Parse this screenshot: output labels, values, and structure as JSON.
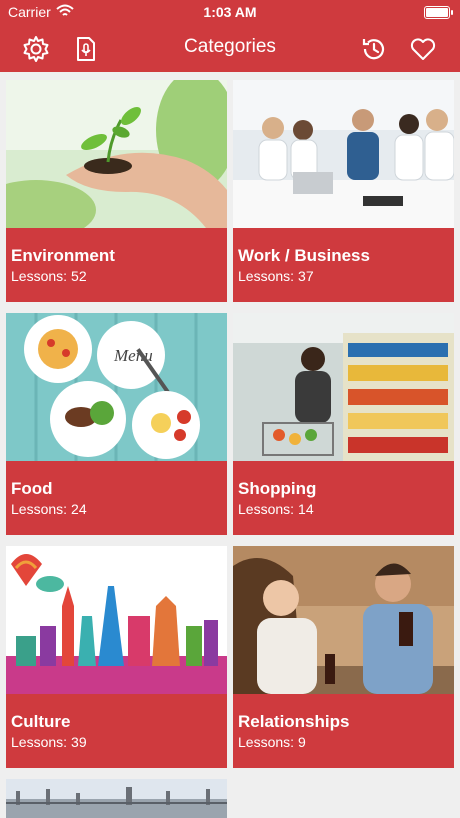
{
  "status_bar": {
    "carrier": "Carrier",
    "time": "1:03 AM",
    "icons": [
      "wifi-icon",
      "battery-icon"
    ]
  },
  "nav": {
    "title": "Categories",
    "left_icons": [
      "gear-icon",
      "speech-doc-icon"
    ],
    "right_icons": [
      "history-icon",
      "heart-icon"
    ]
  },
  "colors": {
    "brand": "#cf3a3e",
    "background": "#efefef",
    "text_on_brand": "#ffffff"
  },
  "lessons_label": "Lessons:",
  "categories": [
    {
      "title": "Environment",
      "lessons": "52",
      "image": "plant-in-hand-image"
    },
    {
      "title": "Work / Business",
      "lessons": "37",
      "image": "office-meeting-image"
    },
    {
      "title": "Food",
      "lessons": "24",
      "image": "food-plates-image"
    },
    {
      "title": "Shopping",
      "lessons": "14",
      "image": "supermarket-image"
    },
    {
      "title": "Culture",
      "lessons": "39",
      "image": "world-landmarks-image"
    },
    {
      "title": "Relationships",
      "lessons": "9",
      "image": "couple-cafe-image"
    },
    {
      "title": "",
      "lessons": "",
      "image": "city-bridge-image"
    }
  ]
}
